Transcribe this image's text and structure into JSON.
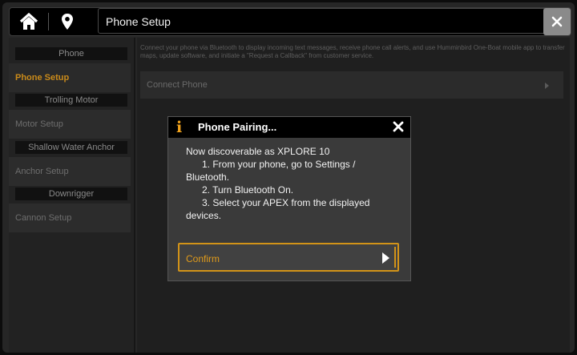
{
  "window": {
    "title": "Phone Setup",
    "icons": {
      "home": "home-icon",
      "location": "location-pin-icon",
      "close": "close-icon"
    }
  },
  "sidebar": {
    "sections": [
      {
        "header": "Phone",
        "items": [
          {
            "label": "Phone Setup",
            "active": true
          }
        ]
      },
      {
        "header": "Trolling Motor",
        "items": [
          {
            "label": "Motor Setup",
            "active": false
          }
        ]
      },
      {
        "header": "Shallow Water Anchor",
        "items": [
          {
            "label": "Anchor Setup",
            "active": false
          }
        ]
      },
      {
        "header": "Downrigger",
        "items": [
          {
            "label": "Cannon Setup",
            "active": false
          }
        ]
      }
    ]
  },
  "main": {
    "description": "Connect your phone via Bluetooth to display incoming text messages, receive phone call alerts, and use Humminbird One-Boat mobile app to transfer maps, update software, and initiate a \"Request a Callback\" from customer service.",
    "connect_phone_label": "Connect Phone"
  },
  "dialog": {
    "title": "Phone Pairing...",
    "info_glyph": "i",
    "line1": "Now discoverable as XPLORE 10",
    "line2": "1. From your phone, go to Settings /",
    "line3": "Bluetooth.",
    "line4": "2. Turn Bluetooth On.",
    "line5": "3. Select your APEX from the displayed",
    "line6": "devices.",
    "confirm_label": "Confirm"
  },
  "colors": {
    "accent": "#d29318",
    "active_text": "#c98a1a",
    "background": "#262626"
  }
}
